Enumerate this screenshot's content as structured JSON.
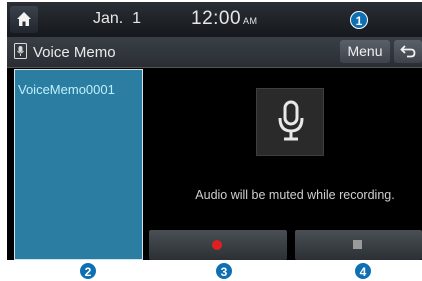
{
  "status_bar": {
    "date": "Jan.  1",
    "time": "12:00",
    "ampm": "AM"
  },
  "title_bar": {
    "title": "Voice Memo",
    "menu_label": "Menu"
  },
  "file_list": {
    "items": [
      "VoiceMemo0001"
    ]
  },
  "main": {
    "message": "Audio will be muted while recording."
  },
  "callouts": [
    "1",
    "2",
    "3",
    "4"
  ],
  "colors": {
    "accent": "#2b7ea1",
    "record": "#e02020",
    "callout": "#0f6fb3"
  }
}
